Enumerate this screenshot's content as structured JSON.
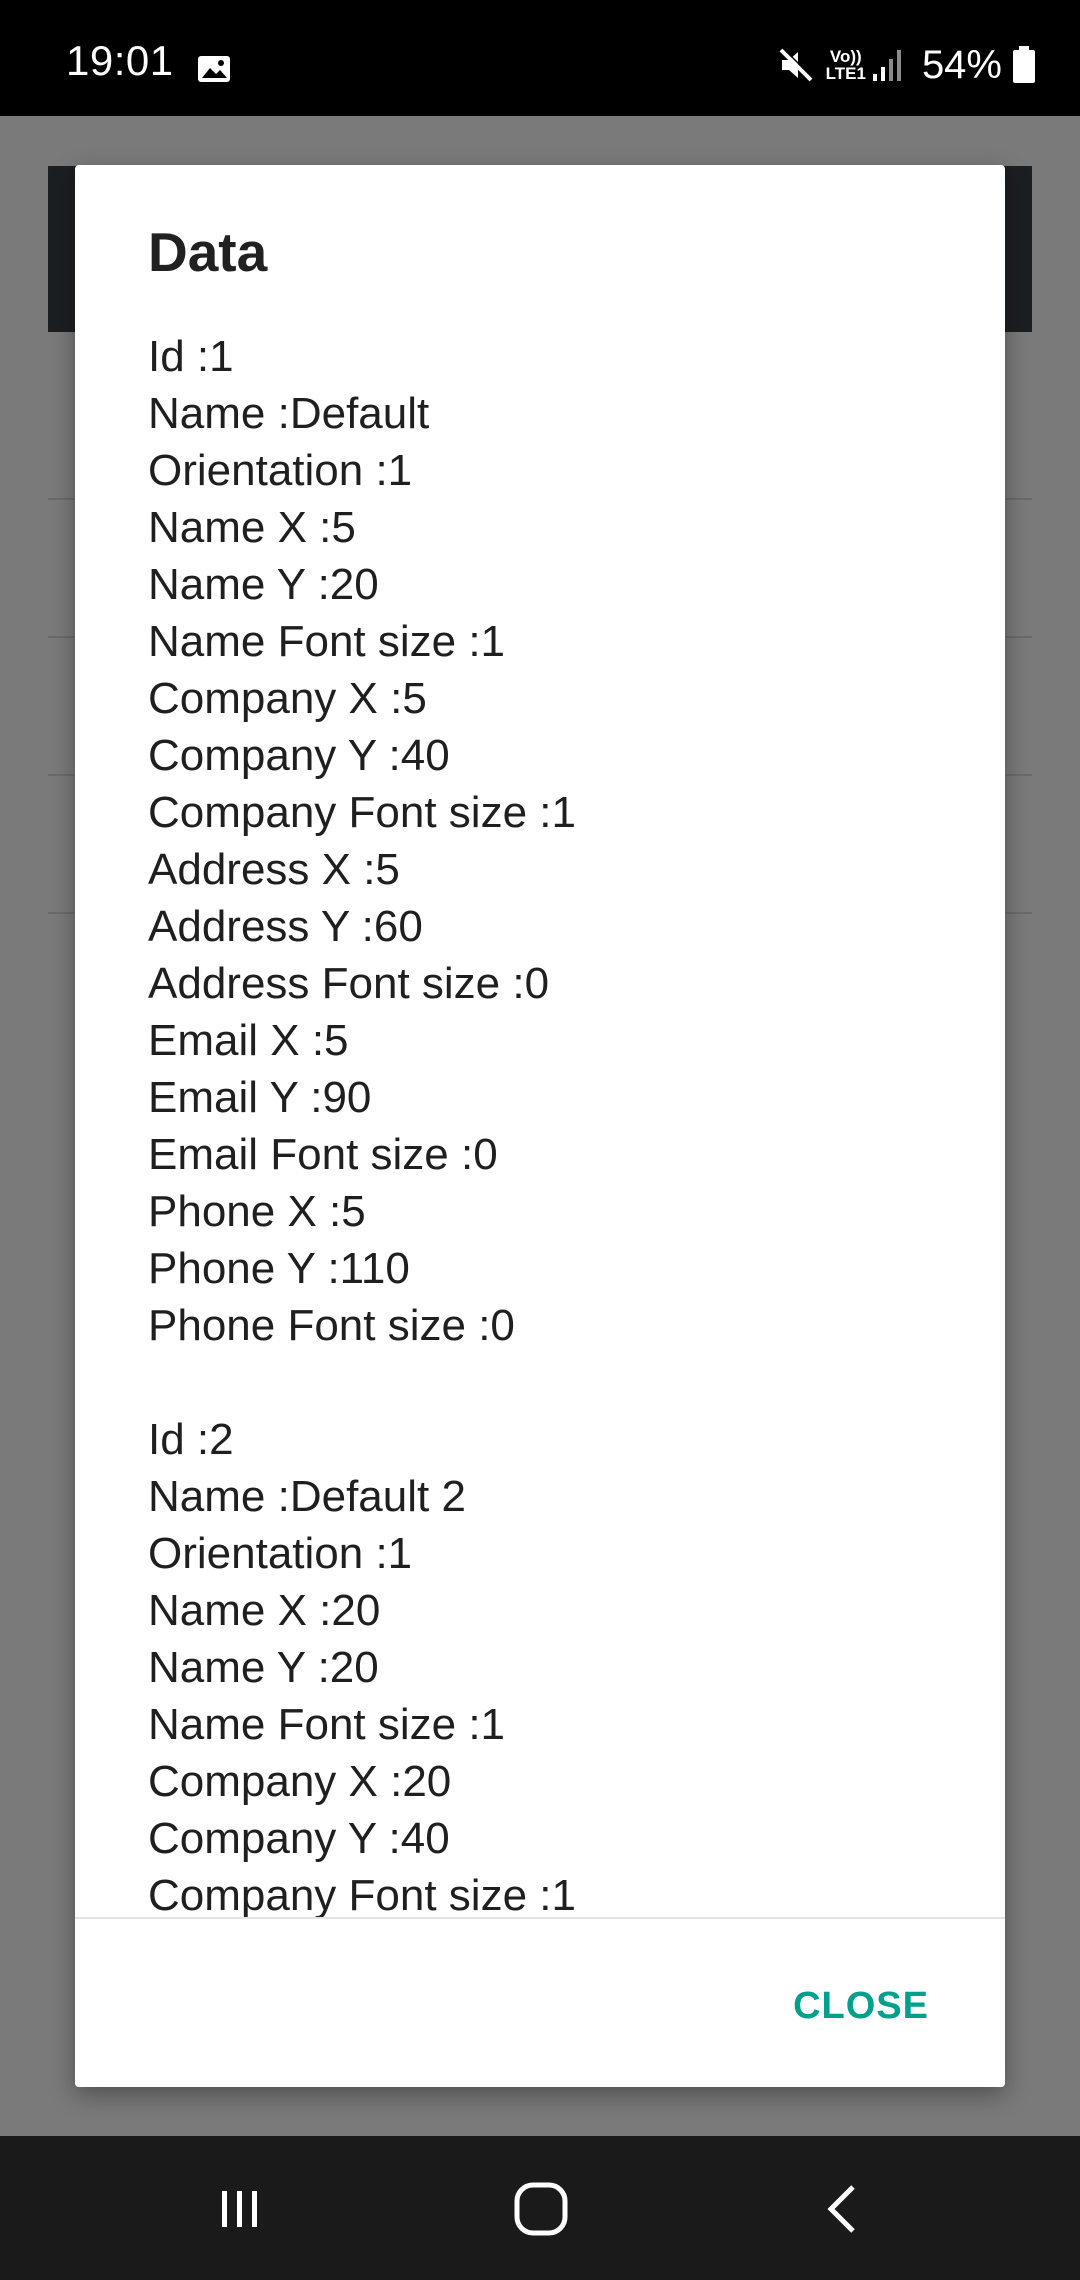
{
  "status_bar": {
    "time": "19:01",
    "network_line1": "Vo))",
    "network_line2": "LTE1",
    "battery": "54%",
    "icons": [
      "gallery-icon",
      "mute-icon",
      "signal-icon",
      "battery-icon"
    ]
  },
  "dialog": {
    "title": "Data",
    "records": [
      {
        "lines": [
          "Id :1",
          "Name :Default",
          "Orientation :1",
          "Name X :5",
          "Name Y :20",
          "Name Font size :1",
          "Company X :5",
          "Company Y :40",
          "Company Font size :1",
          "Address X :5",
          "Address Y :60",
          "Address Font size :0",
          "Email X :5",
          "Email Y :90",
          "Email Font size :0",
          "Phone X :5",
          "Phone Y :110",
          "Phone Font size :0"
        ]
      },
      {
        "lines": [
          "Id :2",
          "Name :Default 2",
          "Orientation :1",
          "Name X :20",
          "Name Y :20",
          "Name Font size :1",
          "Company X :20",
          "Company Y :40",
          "Company Font size :1"
        ]
      }
    ],
    "close_label": "CLOSE"
  },
  "nav_bar": {
    "icons": [
      "recent-apps-icon",
      "home-icon",
      "back-icon"
    ]
  },
  "colors": {
    "accent": "#00a08a",
    "scrim": "#7a7a7a",
    "status_bar": "#000000",
    "nav_bar": "#1a1a1a"
  }
}
